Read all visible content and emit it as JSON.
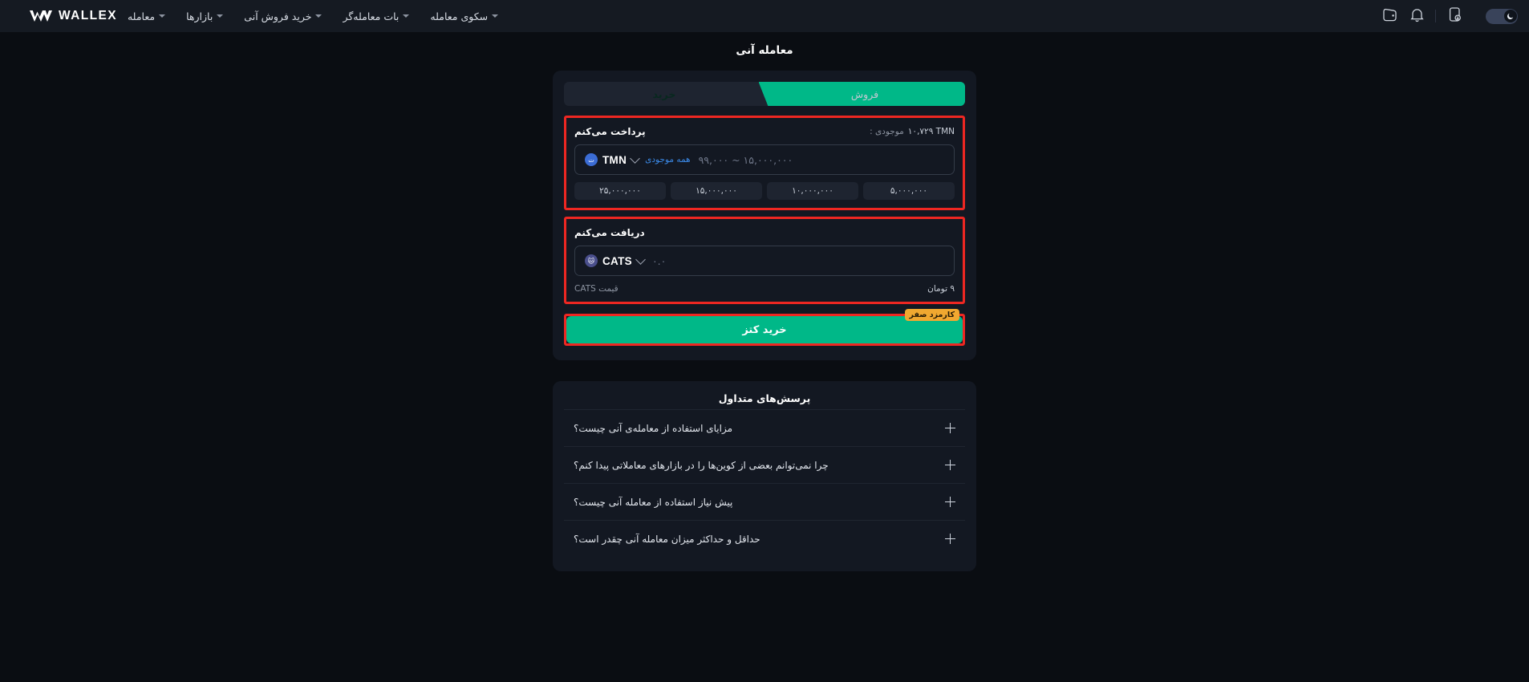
{
  "header": {
    "brand": "WALLEX",
    "nav": [
      {
        "label": "معامله",
        "icon": "chevron-down-icon"
      },
      {
        "label": "بازارها",
        "icon": "chevron-down-icon"
      },
      {
        "label": "خرید فروش آنی",
        "icon": "chevron-down-icon"
      },
      {
        "label": "بات معامله‌گر",
        "icon": "chevron-down-icon"
      },
      {
        "label": "سکوی معامله",
        "icon": "chevron-down-icon"
      }
    ],
    "icons": {
      "dark_toggle": "moon-icon",
      "mobile_app": "mobile-download-icon",
      "notifications": "bell-icon",
      "wallet": "wallet-icon"
    }
  },
  "page": {
    "title": "معامله آنی"
  },
  "tabs": {
    "buy": "خرید",
    "sell": "فروش",
    "active": "خرید"
  },
  "pay": {
    "label": "پرداخت می‌کنم",
    "balance_label": "موجودی :",
    "balance_value": "۱۰,۷۲۹ TMN",
    "currency": "TMN",
    "currency_icon": "toman-coin-icon",
    "use_all": "همه موجودی",
    "placeholder": "۹۹,۰۰۰ ~ ۱۵,۰۰۰,۰۰۰",
    "chips": [
      "۲۵,۰۰۰,۰۰۰",
      "۱۵,۰۰۰,۰۰۰",
      "۱۰,۰۰۰,۰۰۰",
      "۵,۰۰۰,۰۰۰"
    ]
  },
  "receive": {
    "label": "دریافت می‌کنم",
    "currency": "CATS",
    "currency_icon": "cats-coin-icon",
    "value": "۰.۰",
    "price_label": "قیمت CATS",
    "price_value": "۹ تومان"
  },
  "submit": {
    "fee_badge": "کارمزد صفر",
    "button": "خرید کتز"
  },
  "faq": {
    "title": "پرسش‌های متداول",
    "items": [
      {
        "question": "مزایای استفاده از معامله‌ی آنی چیست؟",
        "icon": "plus-icon"
      },
      {
        "question": "چرا نمی‌توانم بعضی از کوین‌ها را در بازارهای معاملاتی پیدا کنم؟",
        "icon": "plus-icon"
      },
      {
        "question": "پیش نیاز استفاده از معامله آنی چیست؟",
        "icon": "plus-icon"
      },
      {
        "question": "حداقل و حداکثر میزان معامله آنی چقدر است؟",
        "icon": "plus-icon"
      }
    ]
  },
  "colors": {
    "accent_green": "#00b888",
    "annotation_red": "#ee2722",
    "badge_orange": "#f0a830",
    "link_blue": "#3b8ae8",
    "page_bg": "#0a0d12",
    "card_bg": "#131822"
  }
}
